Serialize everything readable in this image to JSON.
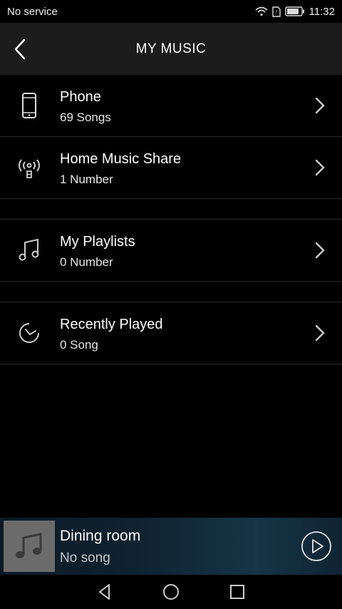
{
  "status": {
    "carrier": "No service",
    "time": "11:32"
  },
  "header": {
    "title": "MY MUSIC"
  },
  "items": [
    {
      "label": "Phone",
      "sub": "69 Songs",
      "icon": "phone-icon"
    },
    {
      "label": "Home Music Share",
      "sub": "1 Number",
      "icon": "wireless-share-icon"
    },
    {
      "label": "My Playlists",
      "sub": "0 Number",
      "icon": "music-note-icon"
    },
    {
      "label": "Recently Played",
      "sub": "0 Song",
      "icon": "clock-icon"
    }
  ],
  "player": {
    "room": "Dining room",
    "song": "No song"
  }
}
